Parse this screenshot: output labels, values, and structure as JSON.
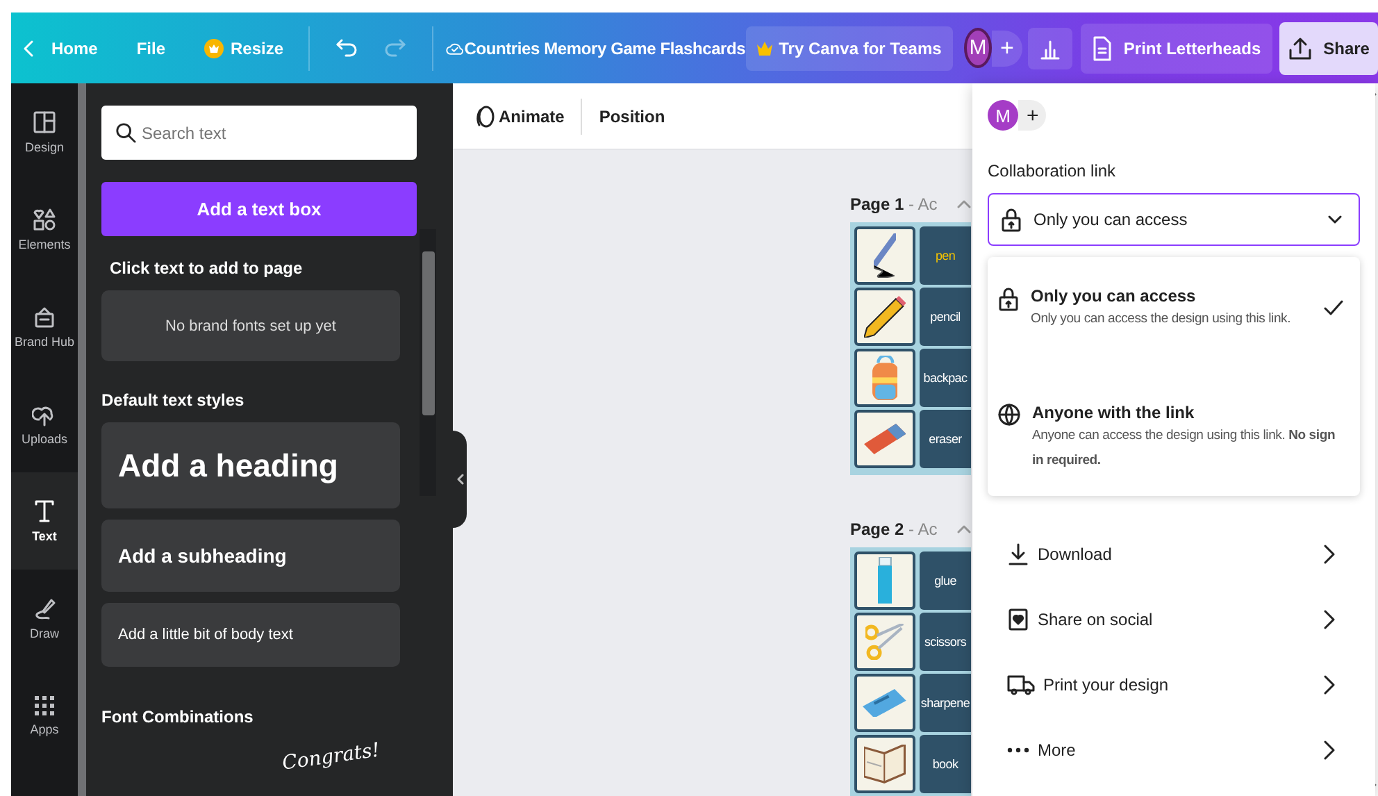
{
  "topbar": {
    "back_label": "Home",
    "menu": [
      "File"
    ],
    "resize": "Resize",
    "redo_disabled": true,
    "title": "Countries Memory Game Flashcards",
    "teams_button": "Try Canva for Teams",
    "avatar": "M",
    "add": "+",
    "print_button": "Print Letterheads",
    "share_button": "Share"
  },
  "nav": [
    {
      "label": "Design",
      "kind": "design",
      "selected": false
    },
    {
      "label": "Elements",
      "kind": "elements",
      "selected": false
    },
    {
      "label": "Brand Hub",
      "kind": "brand",
      "selected": false
    },
    {
      "label": "Uploads",
      "kind": "uploads",
      "selected": false
    },
    {
      "label": "Text",
      "kind": "text",
      "selected": true
    },
    {
      "label": "Draw",
      "kind": "draw",
      "selected": false
    },
    {
      "label": "Apps",
      "kind": "apps",
      "selected": false
    }
  ],
  "text_panel": {
    "search": {
      "placeholder": "Search text"
    },
    "add_button": "Add a text box",
    "click_hint": "Click text to add to page",
    "brand_fonts": "No brand fonts set up yet",
    "default_heading": "Default text styles",
    "styles": [
      {
        "kind": "heading",
        "text": "Add a heading"
      },
      {
        "kind": "subheading",
        "text": "Add a subheading"
      },
      {
        "kind": "body",
        "text": "Add a little bit of body text"
      }
    ],
    "combinations_heading": "Font Combinations",
    "combination_sample": "Congrats!"
  },
  "toolbar": [
    {
      "kind": "animate",
      "label": "Animate"
    },
    {
      "kind": "plain",
      "label": "Position"
    }
  ],
  "pages": [
    {
      "label": "Page 1",
      "title": "- Ac",
      "cards": [
        {
          "kind": "pen",
          "word": "pen",
          "selected": true
        },
        {
          "kind": "pencil",
          "word": "pencil",
          "selected": false
        },
        {
          "kind": "backpack",
          "word": "backpac",
          "selected": false
        },
        {
          "kind": "eraser",
          "word": "eraser",
          "selected": false
        }
      ]
    },
    {
      "label": "Page 2",
      "title": "- Ac",
      "cards": [
        {
          "kind": "glue",
          "word": "glue",
          "selected": false
        },
        {
          "kind": "scissors",
          "word": "scissors",
          "selected": false
        },
        {
          "kind": "sharpener",
          "word": "sharpene",
          "selected": false
        },
        {
          "kind": "book",
          "word": "book",
          "selected": false
        }
      ]
    }
  ],
  "share": {
    "avatar": "M",
    "add": "+",
    "link_heading": "Collaboration link",
    "access": "Only you can access",
    "options": [
      {
        "kind": "private",
        "title": "Only you can access",
        "description": "Only you can access the design using this link.",
        "selected": true
      },
      {
        "kind": "public",
        "title": "Anyone with the link",
        "description": "Anyone can access the design using this link. **No sign in required.**",
        "selected": false
      }
    ],
    "actions": [
      {
        "kind": "download",
        "label": "Download"
      },
      {
        "kind": "social",
        "label": "Share on social"
      },
      {
        "kind": "print",
        "label": "Print your design"
      },
      {
        "kind": "more",
        "label": "More"
      }
    ]
  }
}
